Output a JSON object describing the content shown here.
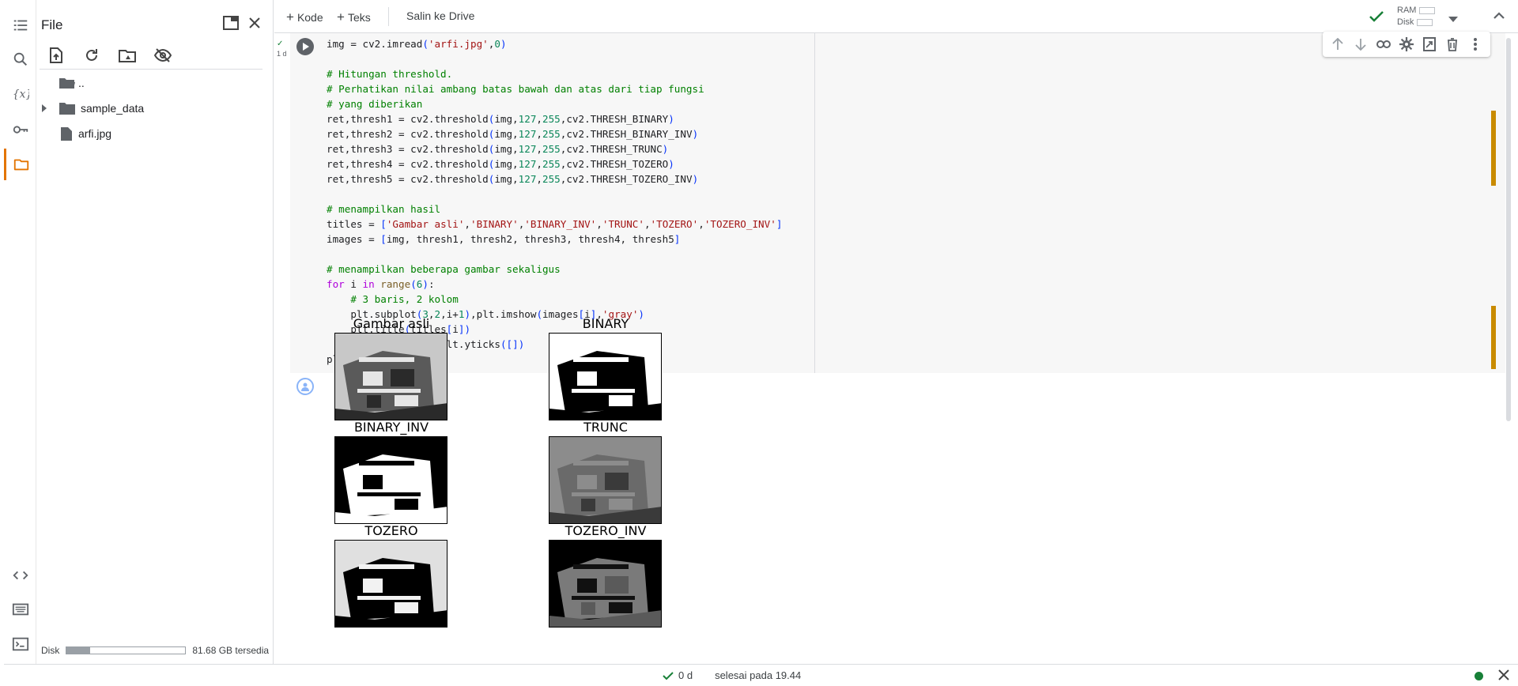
{
  "sidebar": {
    "title": "File",
    "tree": [
      {
        "label": ".."
      },
      {
        "label": "sample_data"
      },
      {
        "label": "arfi.jpg"
      }
    ],
    "disk": {
      "label": "Disk",
      "free_text": "81.68 GB tersedia",
      "used_fraction": 0.2
    }
  },
  "toolbar": {
    "add_code": "Kode",
    "add_text": "Teks",
    "copy_to_drive": "Salin ke Drive",
    "ram_label": "RAM",
    "disk_label": "Disk"
  },
  "cell": {
    "status": "1 d",
    "code": [
      "img = cv2.imread('arfi.jpg',0)",
      "",
      "# Hitungan threshold.",
      "# Perhatikan nilai ambang batas bawah dan atas dari tiap fungsi",
      "# yang diberikan",
      "ret,thresh1 = cv2.threshold(img,127,255,cv2.THRESH_BINARY)",
      "ret,thresh2 = cv2.threshold(img,127,255,cv2.THRESH_BINARY_INV)",
      "ret,thresh3 = cv2.threshold(img,127,255,cv2.THRESH_TRUNC)",
      "ret,thresh4 = cv2.threshold(img,127,255,cv2.THRESH_TOZERO)",
      "ret,thresh5 = cv2.threshold(img,127,255,cv2.THRESH_TOZERO_INV)",
      "",
      "# menampilkan hasil",
      "titles = ['Gambar asli','BINARY','BINARY_INV','TRUNC','TOZERO','TOZERO_INV']",
      "images = [img, thresh1, thresh2, thresh3, thresh4, thresh5]",
      "",
      "# menampilkan beberapa gambar sekaligus",
      "for i in range(6):",
      "    # 3 baris, 2 kolom",
      "    plt.subplot(3,2,i+1),plt.imshow(images[i],'gray')",
      "    plt.title(titles[i])",
      "    plt.xticks([]),plt.yticks([])",
      "plt.show()"
    ]
  },
  "output": {
    "plots": [
      {
        "title": "Gambar asli",
        "style": "gray"
      },
      {
        "title": "BINARY",
        "style": "binary"
      },
      {
        "title": "BINARY_INV",
        "style": "binary_inv"
      },
      {
        "title": "TRUNC",
        "style": "trunc"
      },
      {
        "title": "TOZERO",
        "style": "tozero"
      },
      {
        "title": "TOZERO_INV",
        "style": "tozero_inv"
      }
    ]
  },
  "statusbar": {
    "duration": "0 d",
    "finished": "selesai pada 19.44"
  },
  "colors": {
    "accent": "#e37400",
    "success": "#188038",
    "connected_dot": "#188038",
    "change_marker": "#c98b00"
  }
}
